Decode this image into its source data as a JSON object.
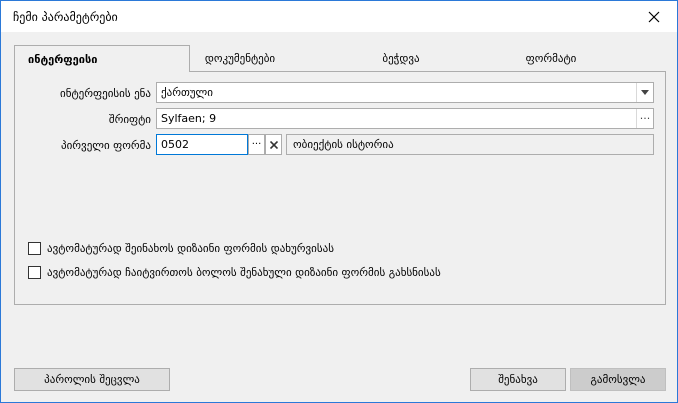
{
  "window": {
    "title": "ჩემი პარამეტრები"
  },
  "tabs": [
    {
      "label": "ინტერფეისი",
      "active": true
    },
    {
      "label": "დოკუმენტები",
      "active": false
    },
    {
      "label": "ბეჭდვა",
      "active": false
    },
    {
      "label": "ფორმატი",
      "active": false
    }
  ],
  "fields": {
    "language": {
      "label": "ინტერფეისის ენა",
      "value": "ქართული"
    },
    "font": {
      "label": "შრიფტი",
      "value": "Sylfaen; 9"
    },
    "first_form": {
      "label": "პირველი ფორმა",
      "value": "0502",
      "description": "ობიექტის ისტორია"
    }
  },
  "checkboxes": [
    {
      "label": "ავტომატურად შეინახოს დიზაინი ფორმის დახურვისას",
      "checked": false
    },
    {
      "label": "ავტომატურად ჩაიტვირთოს ბოლოს შენახული დიზაინი ფორმის გახსნისას",
      "checked": false
    }
  ],
  "buttons": {
    "change_password": "პაროლის შეცვლა",
    "save": "შენახვა",
    "close": "გამოსვლა"
  }
}
